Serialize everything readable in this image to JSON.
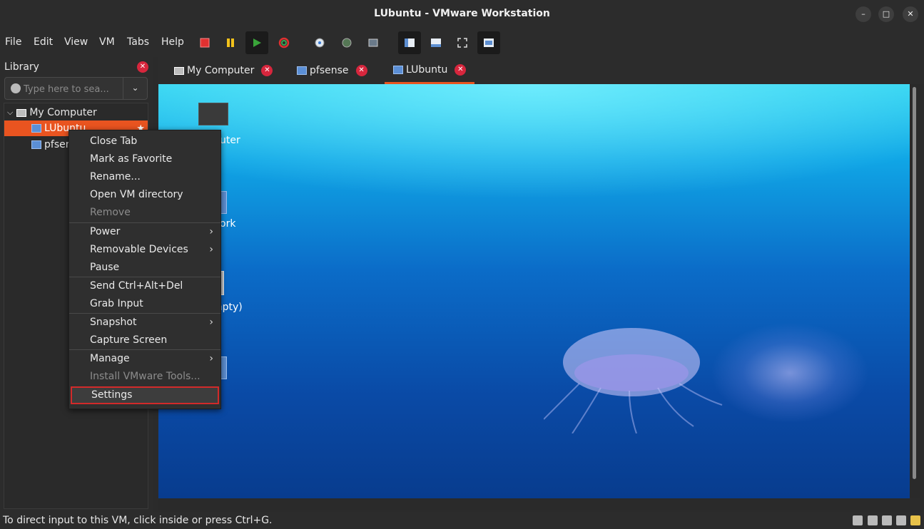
{
  "window": {
    "title": "LUbuntu - VMware Workstation"
  },
  "menubar": {
    "items": [
      "File",
      "Edit",
      "View",
      "VM",
      "Tabs",
      "Help"
    ]
  },
  "sidebar": {
    "title": "Library",
    "search_placeholder": "Type here to sea...",
    "tree": {
      "root": "My Computer",
      "items": [
        "LUbuntu",
        "pfsense"
      ]
    }
  },
  "tabs": [
    {
      "label": "My Computer"
    },
    {
      "label": "pfsense"
    },
    {
      "label": "LUbuntu",
      "active": true
    }
  ],
  "vm_desktop": {
    "labels": [
      "uter",
      "ork",
      "mpty)"
    ]
  },
  "context_menu": {
    "items": [
      {
        "label": "Close Tab"
      },
      {
        "label": "Mark as Favorite"
      },
      {
        "label": "Rename..."
      },
      {
        "label": "Open VM directory"
      },
      {
        "label": "Remove",
        "disabled": true
      },
      {
        "label": "Power",
        "submenu": true
      },
      {
        "label": "Removable Devices",
        "submenu": true
      },
      {
        "label": "Pause"
      },
      {
        "label": "Send Ctrl+Alt+Del"
      },
      {
        "label": "Grab Input"
      },
      {
        "label": "Snapshot",
        "submenu": true
      },
      {
        "label": "Capture Screen"
      },
      {
        "label": "Manage",
        "submenu": true
      },
      {
        "label": "Install VMware Tools...",
        "disabled": true
      },
      {
        "label": "Settings",
        "highlighted": true
      }
    ]
  },
  "statusbar": {
    "text": "To direct input to this VM, click inside or press Ctrl+G."
  },
  "colors": {
    "accent": "#e95420",
    "close": "#d7263d",
    "highlight_border": "#d22a2a"
  }
}
